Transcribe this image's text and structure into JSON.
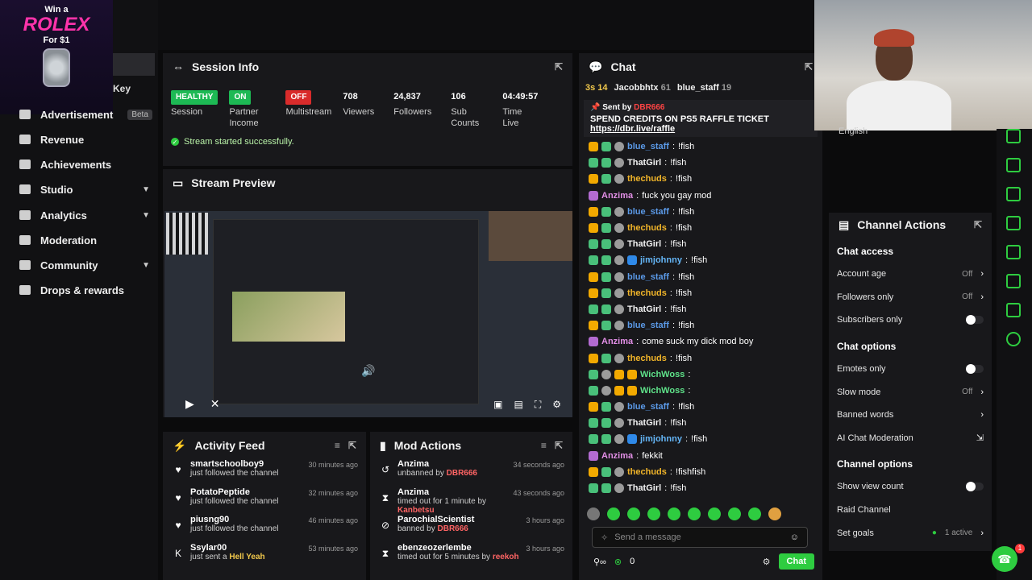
{
  "promo": {
    "line1": "Win a",
    "brand": "ROLEX",
    "line3": "For $1"
  },
  "sidebar": {
    "key_label": "Key",
    "items": [
      {
        "label": "Advertisement",
        "badge": "Beta",
        "icon": "list-icon"
      },
      {
        "label": "Revenue",
        "icon": "wallet-icon"
      },
      {
        "label": "Achievements",
        "icon": "trophy-icon"
      },
      {
        "label": "Studio",
        "icon": "studio-icon",
        "expandable": true
      },
      {
        "label": "Analytics",
        "icon": "chart-icon",
        "expandable": true
      },
      {
        "label": "Moderation",
        "icon": "hammer-icon"
      },
      {
        "label": "Community",
        "icon": "people-icon",
        "expandable": true
      },
      {
        "label": "Drops & rewards",
        "icon": "gift-icon"
      }
    ]
  },
  "session": {
    "title": "Session Info",
    "stats": [
      {
        "value": "HEALTHY",
        "label": "Session",
        "kind": "pill-green"
      },
      {
        "value": "ON",
        "label": "Partner Income",
        "kind": "pill-green"
      },
      {
        "value": "OFF",
        "label": "Multistream",
        "kind": "pill-red"
      },
      {
        "value": "708",
        "label": "Viewers"
      },
      {
        "value": "24,837",
        "label": "Followers"
      },
      {
        "value": "106",
        "label": "Sub Counts"
      },
      {
        "value": "04:49:57",
        "label": "Time Live"
      }
    ],
    "success_message": "Stream started successfully."
  },
  "preview": {
    "title": "Stream Preview"
  },
  "activity": {
    "title": "Activity Feed",
    "rows": [
      {
        "name": "smartschoolboy9",
        "sub": "just followed the channel",
        "time": "30 minutes ago",
        "icon": "heart-icon"
      },
      {
        "name": "PotatoPeptide",
        "sub": "just followed the channel",
        "time": "32 minutes ago",
        "icon": "heart-icon"
      },
      {
        "name": "piusng90",
        "sub": "just followed the channel",
        "time": "46 minutes ago",
        "icon": "heart-icon"
      },
      {
        "name": "Ssylar00",
        "sub_prefix": "just sent a ",
        "sub_highlight": "Hell Yeah",
        "time": "53 minutes ago",
        "icon": "kick-icon"
      }
    ]
  },
  "mod_actions": {
    "title": "Mod Actions",
    "rows": [
      {
        "name": "Anzima",
        "sub_prefix": "unbanned by ",
        "sub_highlight": "DBR666",
        "time": "34 seconds ago",
        "icon": "undo-icon"
      },
      {
        "name": "Anzima",
        "sub_prefix": "timed out for 1 minute by ",
        "sub_highlight": "Kanbetsu",
        "time": "43 seconds ago",
        "icon": "hourglass-icon"
      },
      {
        "name": "ParochialScientist",
        "sub_prefix": "banned by ",
        "sub_highlight": "DBR666",
        "time": "3 hours ago",
        "icon": "ban-icon"
      },
      {
        "name": "ebenzeozerlembe",
        "sub_prefix": "timed out for 5 minutes by ",
        "sub_highlight": "reekoh",
        "time": "3 hours ago",
        "icon": "hourglass-icon"
      }
    ]
  },
  "chat": {
    "title": "Chat",
    "top_users": [
      {
        "name": "Jacobbhtx",
        "count": "61"
      },
      {
        "name": "blue_staff",
        "count": "19"
      }
    ],
    "top_prefix": "3s 14",
    "pinned": {
      "sent_by": "Sent by",
      "sender": "DBR666",
      "message": "SPEND CREDITS ON PS5 RAFFLE TICKET",
      "url": "https://dbr.live/raffle"
    },
    "messages": [
      {
        "user": "blue_staff",
        "color": "blue",
        "badges": [
          "gold",
          "green",
          "grey"
        ],
        "text": "!fish"
      },
      {
        "user": "ThatGirl",
        "color": "white",
        "badges": [
          "green",
          "green",
          "grey"
        ],
        "text": "!fish"
      },
      {
        "user": "thechuds",
        "color": "gold",
        "badges": [
          "gold",
          "green",
          "grey"
        ],
        "text": "!fish"
      },
      {
        "user": "Anzima",
        "color": "pink",
        "badges": [
          "pink"
        ],
        "text": "fuck you gay mod"
      },
      {
        "user": "blue_staff",
        "color": "blue",
        "badges": [
          "gold",
          "green",
          "grey"
        ],
        "text": "!fish"
      },
      {
        "user": "thechuds",
        "color": "gold",
        "badges": [
          "gold",
          "green",
          "grey"
        ],
        "text": "!fish"
      },
      {
        "user": "ThatGirl",
        "color": "white",
        "badges": [
          "green",
          "green",
          "grey"
        ],
        "text": "!fish"
      },
      {
        "user": "jimjohnny",
        "color": "sky",
        "badges": [
          "green",
          "green",
          "grey",
          "blue"
        ],
        "text": "!fish"
      },
      {
        "user": "blue_staff",
        "color": "blue",
        "badges": [
          "gold",
          "green",
          "grey"
        ],
        "text": "!fish"
      },
      {
        "user": "thechuds",
        "color": "gold",
        "badges": [
          "gold",
          "green",
          "grey"
        ],
        "text": "!fish"
      },
      {
        "user": "ThatGirl",
        "color": "white",
        "badges": [
          "green",
          "green",
          "grey"
        ],
        "text": "!fish"
      },
      {
        "user": "blue_staff",
        "color": "blue",
        "badges": [
          "gold",
          "green",
          "grey"
        ],
        "text": "!fish"
      },
      {
        "user": "Anzima",
        "color": "pink",
        "badges": [
          "pink"
        ],
        "text": "come suck my dick mod boy"
      },
      {
        "user": "thechuds",
        "color": "gold",
        "badges": [
          "gold",
          "green",
          "grey"
        ],
        "text": "!fish"
      },
      {
        "user": "WichWoss",
        "color": "green",
        "badges": [
          "green",
          "grey",
          "gold",
          "gold"
        ],
        "text": ""
      },
      {
        "user": "WichWoss",
        "color": "green",
        "badges": [
          "green",
          "grey",
          "gold",
          "gold"
        ],
        "text": ""
      },
      {
        "user": "blue_staff",
        "color": "blue",
        "badges": [
          "gold",
          "green",
          "grey"
        ],
        "text": "!fish"
      },
      {
        "user": "ThatGirl",
        "color": "white",
        "badges": [
          "green",
          "green",
          "grey"
        ],
        "text": "!fish"
      },
      {
        "user": "jimjohnny",
        "color": "sky",
        "badges": [
          "green",
          "green",
          "grey",
          "blue"
        ],
        "text": "!fish"
      },
      {
        "user": "Anzima",
        "color": "pink",
        "badges": [
          "pink"
        ],
        "text": "fekkit"
      },
      {
        "user": "thechuds",
        "color": "gold",
        "badges": [
          "gold",
          "green",
          "grey"
        ],
        "text": "!fishfish"
      },
      {
        "user": "ThatGirl",
        "color": "white",
        "badges": [
          "green",
          "green",
          "grey"
        ],
        "text": "!fish"
      }
    ],
    "input_placeholder": "Send a message",
    "viewer_count": "0",
    "send_label": "Chat"
  },
  "webcam": {
    "language": "English"
  },
  "channel_actions": {
    "title": "Channel Actions",
    "sections": [
      {
        "title": "Chat access",
        "options": [
          {
            "label": "Account age",
            "state": "Off",
            "control": "chevron"
          },
          {
            "label": "Followers only",
            "state": "Off",
            "control": "chevron"
          },
          {
            "label": "Subscribers only",
            "state": "",
            "control": "toggle"
          }
        ]
      },
      {
        "title": "Chat options",
        "options": [
          {
            "label": "Emotes only",
            "state": "",
            "control": "toggle"
          },
          {
            "label": "Slow mode",
            "state": "Off",
            "control": "chevron"
          },
          {
            "label": "Banned words",
            "state": "",
            "control": "chevron"
          },
          {
            "label": "AI Chat Moderation",
            "state": "",
            "control": "external"
          }
        ]
      },
      {
        "title": "Channel options",
        "options": [
          {
            "label": "Show view count",
            "state": "",
            "control": "toggle"
          },
          {
            "label": "Raid Channel",
            "state": "",
            "control": "none"
          },
          {
            "label": "Set goals",
            "state": "1 active",
            "control": "chevron"
          }
        ]
      }
    ]
  },
  "help_badge": "1",
  "colors": {
    "accent": "#2ecc40",
    "danger": "#d92b2b",
    "panel": "#18181b"
  }
}
